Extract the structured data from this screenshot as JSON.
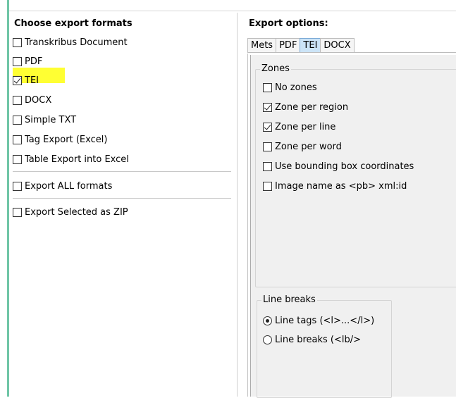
{
  "left": {
    "title": "Choose export formats",
    "formats": [
      {
        "label": "Transkribus Document",
        "checked": false
      },
      {
        "label": "PDF",
        "checked": false
      },
      {
        "label": "TEI",
        "checked": true
      },
      {
        "label": "DOCX",
        "checked": false
      },
      {
        "label": "Simple TXT",
        "checked": false
      },
      {
        "label": "Tag Export (Excel)",
        "checked": false
      },
      {
        "label": "Table Export into Excel",
        "checked": false
      }
    ],
    "export_all": {
      "label": "Export ALL formats",
      "checked": false
    },
    "export_zip": {
      "label": "Export Selected as ZIP",
      "checked": false
    }
  },
  "right": {
    "title": "Export options:",
    "tabs": [
      "Mets",
      "PDF",
      "TEI",
      "DOCX"
    ],
    "active_tab": "TEI",
    "zones": {
      "legend": "Zones",
      "options": [
        {
          "label": "No zones",
          "checked": false
        },
        {
          "label": "Zone per region",
          "checked": true
        },
        {
          "label": "Zone per line",
          "checked": true
        },
        {
          "label": "Zone per word",
          "checked": false
        },
        {
          "label": "Use bounding box coordinates",
          "checked": false
        },
        {
          "label": "Image name as <pb> xml:id",
          "checked": false
        }
      ]
    },
    "line_breaks": {
      "legend": "Line breaks",
      "options": [
        {
          "label": "Line tags (<l>...</l>)",
          "selected": true
        },
        {
          "label": "Line breaks (<lb/>",
          "selected": false
        }
      ]
    }
  },
  "colors": {
    "highlight": "#ffff33",
    "accent": "#6fc5a6",
    "active_tab": "#cce4f7"
  }
}
